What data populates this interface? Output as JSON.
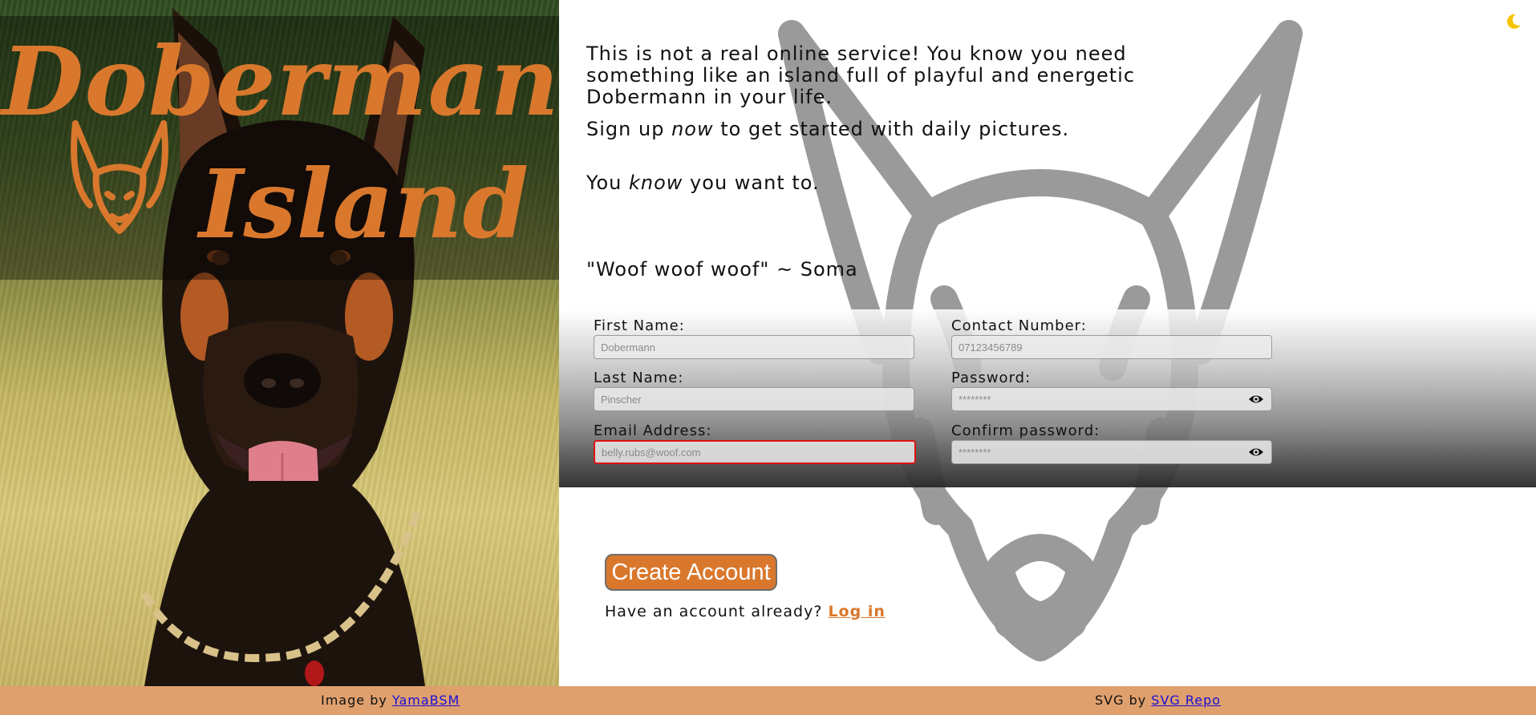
{
  "brand": {
    "line1": "Dobermann",
    "line2": "Island",
    "logo_icon": "dobermann-head-icon"
  },
  "intro": {
    "paragraph": "This is not a real online service! You know you need something like an island full of playful and energetic Dobermann in your life.",
    "signup_before": "Sign up ",
    "signup_em": "now",
    "signup_after": " to get started with daily pictures.",
    "know_before": "You ",
    "know_em": "know",
    "know_after": " you want to.",
    "quote": "\"Woof woof woof\" ~ Soma"
  },
  "form": {
    "first_name": {
      "label": "First Name:",
      "placeholder": "Dobermann"
    },
    "last_name": {
      "label": "Last Name:",
      "placeholder": "Pinscher"
    },
    "email": {
      "label": "Email Address:",
      "placeholder": "belly.rubs@woof.com"
    },
    "contact": {
      "label": "Contact Number:",
      "placeholder": "07123456789"
    },
    "password": {
      "label": "Password:",
      "placeholder": "********"
    },
    "confirm_password": {
      "label": "Confirm password:",
      "placeholder": "********"
    },
    "submit_label": "Create Account",
    "login_prompt": "Have an account already? ",
    "login_link": "Log in"
  },
  "footer": {
    "image_credit_prefix": "Image by ",
    "image_credit_link": "YamaBSM",
    "svg_credit_prefix": "SVG by ",
    "svg_credit_link": "SVG Repo"
  },
  "icons": {
    "theme_toggle": "moon-icon",
    "password_reveal": "eye-icon"
  },
  "colors": {
    "accent": "#d9782d",
    "footer_bg": "#dfa06e",
    "invalid_border": "#e01010",
    "link": "#1a0fd6",
    "moon": "#f5c400"
  }
}
